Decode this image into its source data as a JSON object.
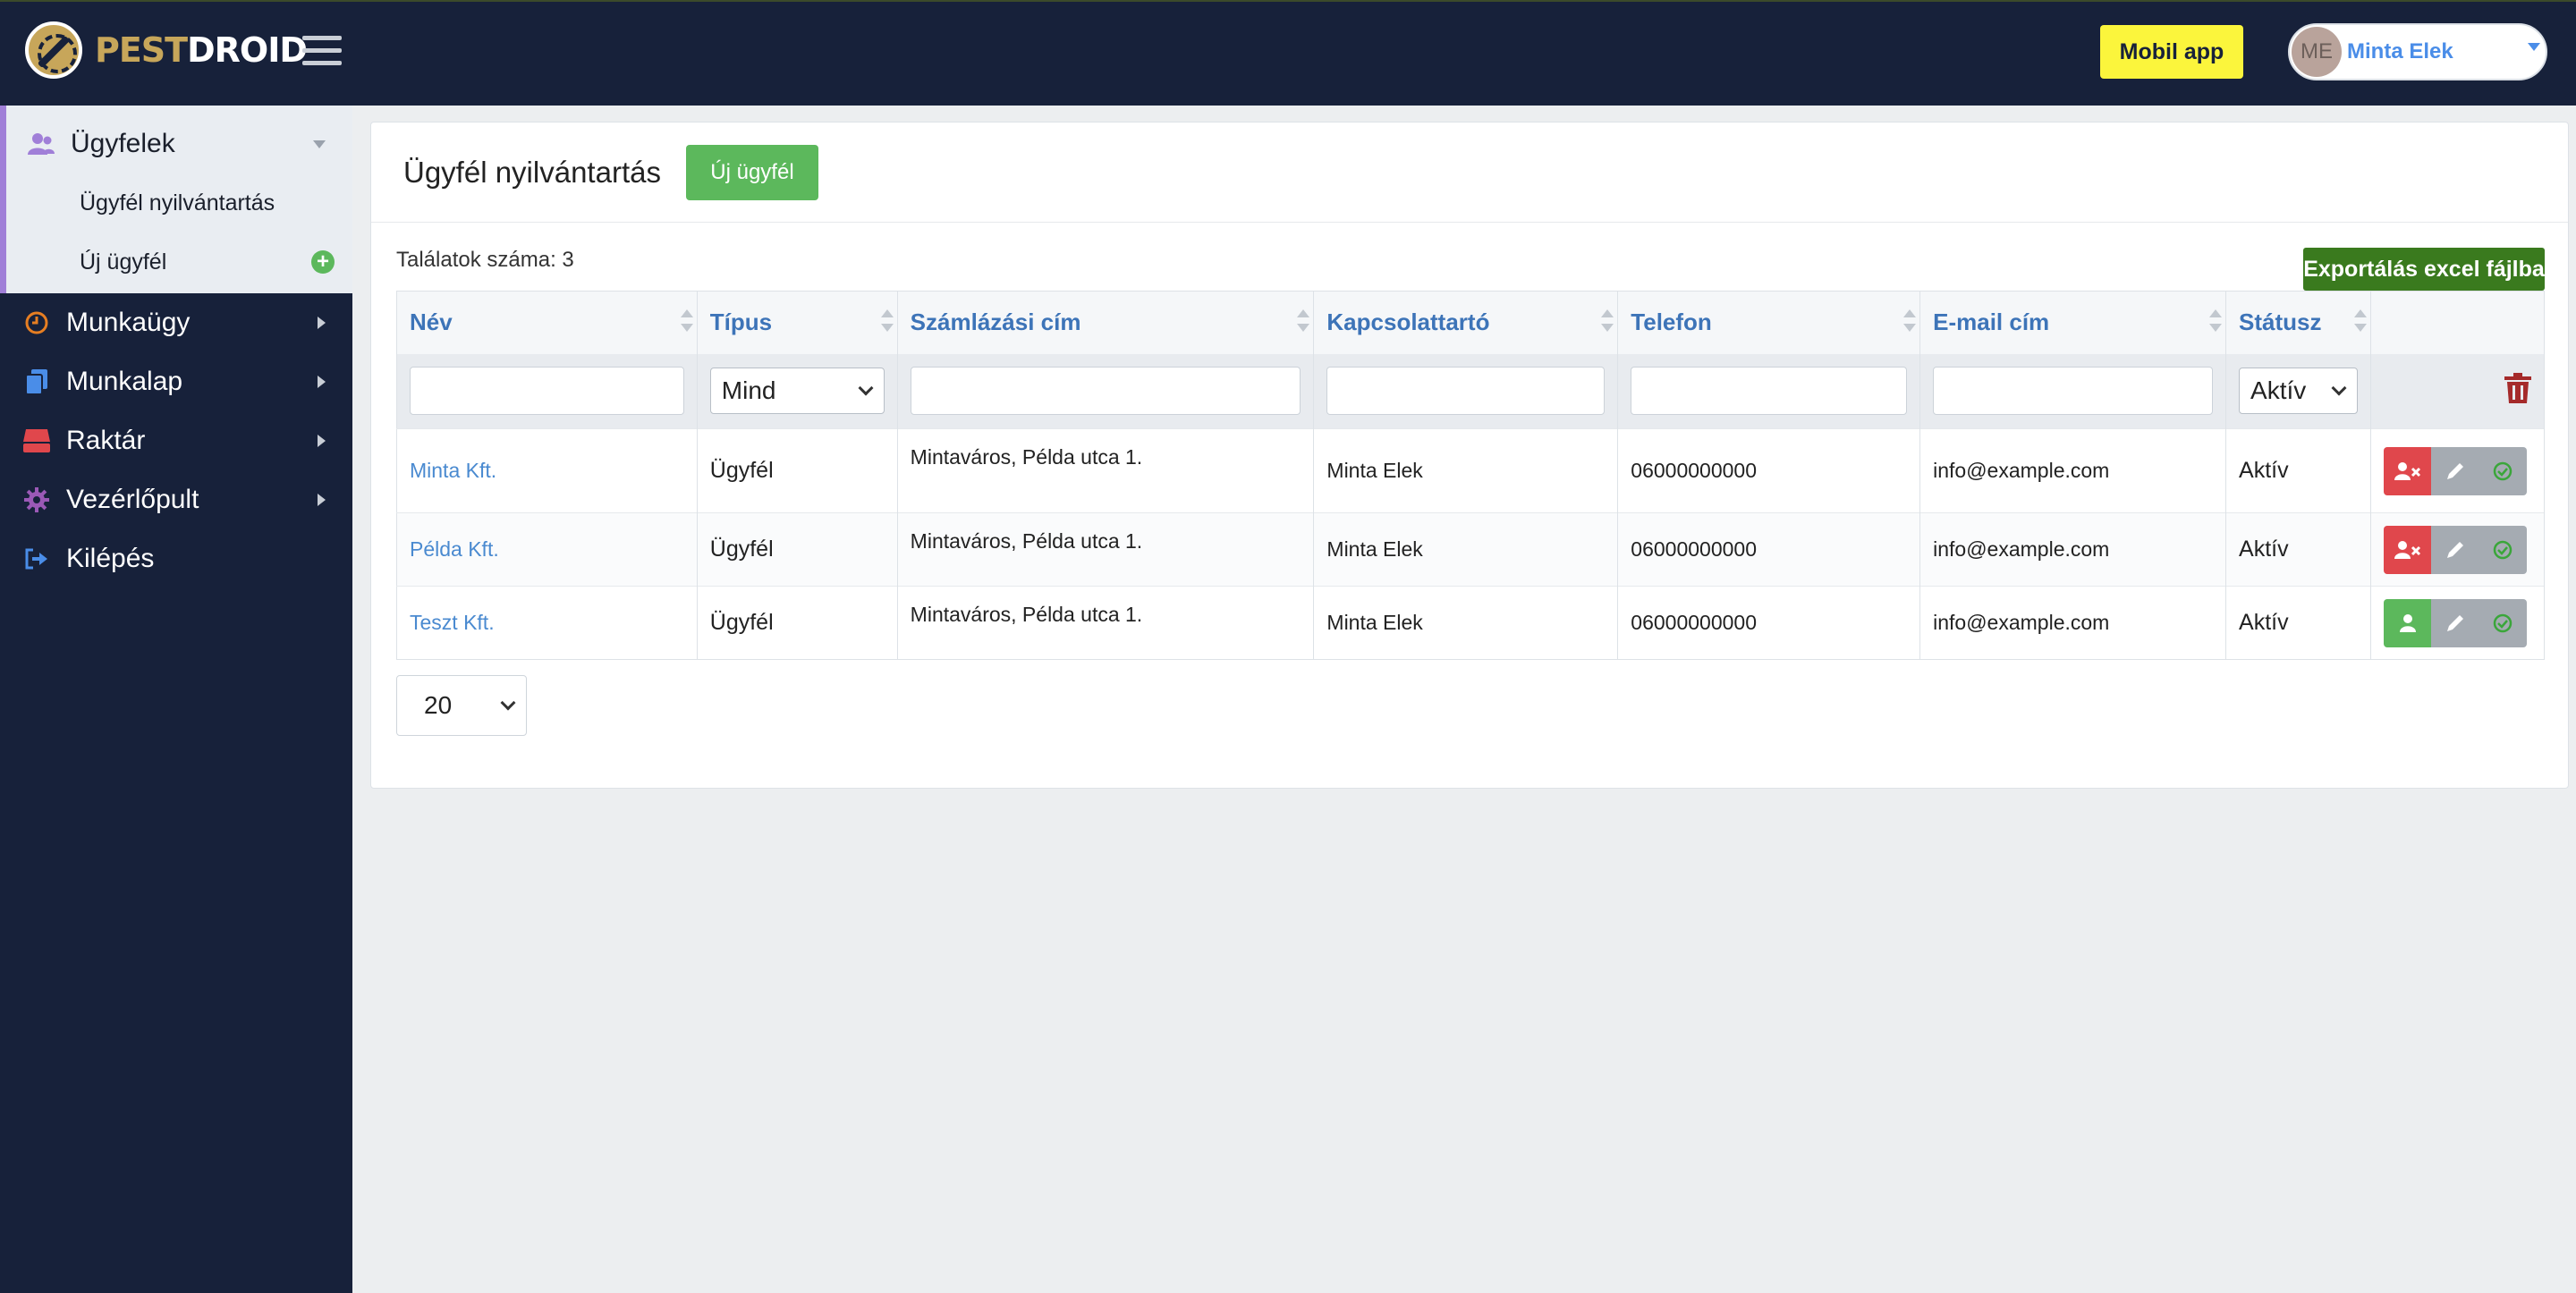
{
  "brand": {
    "part1": "PEST",
    "part2": "DROID"
  },
  "header": {
    "mobile_app": "Mobil app",
    "user_initials": "ME",
    "user_name": "Minta Elek"
  },
  "sidebar": {
    "open_group": {
      "label": "Ügyfelek",
      "items": [
        {
          "label": "Ügyfél nyilvántartás"
        },
        {
          "label": "Új ügyfél"
        }
      ]
    },
    "items": [
      {
        "label": "Munkaügy",
        "icon": "clock-icon"
      },
      {
        "label": "Munkalap",
        "icon": "copy-icon"
      },
      {
        "label": "Raktár",
        "icon": "warehouse-icon"
      },
      {
        "label": "Vezérlőpult",
        "icon": "gear-icon"
      },
      {
        "label": "Kilépés",
        "icon": "logout-icon"
      }
    ]
  },
  "page": {
    "title": "Ügyfél nyilvántartás",
    "new_button": "Új ügyfél",
    "results": "Találatok száma: 3",
    "export_button": "Exportálás excel fájlba",
    "per_page": "20"
  },
  "table": {
    "columns": [
      "Név",
      "Típus",
      "Számlázási cím",
      "Kapcsolattartó",
      "Telefon",
      "E-mail cím",
      "Státusz"
    ],
    "filters": {
      "type": "Mind",
      "status": "Aktív"
    },
    "rows": [
      {
        "name": "Minta Kft.",
        "type": "Ügyfél",
        "address": "Mintaváros, Példa utca 1.",
        "contact": "Minta Elek",
        "phone": "06000000000",
        "email": "info@example.com",
        "status": "Aktív",
        "first_action": "deactivate"
      },
      {
        "name": "Példa Kft.",
        "type": "Ügyfél",
        "address": "Mintaváros, Példa utca 1.",
        "contact": "Minta Elek",
        "phone": "06000000000",
        "email": "info@example.com",
        "status": "Aktív",
        "first_action": "deactivate"
      },
      {
        "name": "Teszt Kft.",
        "type": "Ügyfél",
        "address": "Mintaváros, Példa utca 1.",
        "contact": "Minta Elek",
        "phone": "06000000000",
        "email": "info@example.com",
        "status": "Aktív",
        "first_action": "activate"
      }
    ]
  },
  "colors": {
    "nav_bg": "#17213a",
    "accent_gold": "#c7a65a",
    "link_blue": "#4a8ad0",
    "success": "#5cb85c",
    "danger": "#e0474c",
    "export_green": "#3a7a1e",
    "mobile_yellow": "#fbf53c"
  }
}
